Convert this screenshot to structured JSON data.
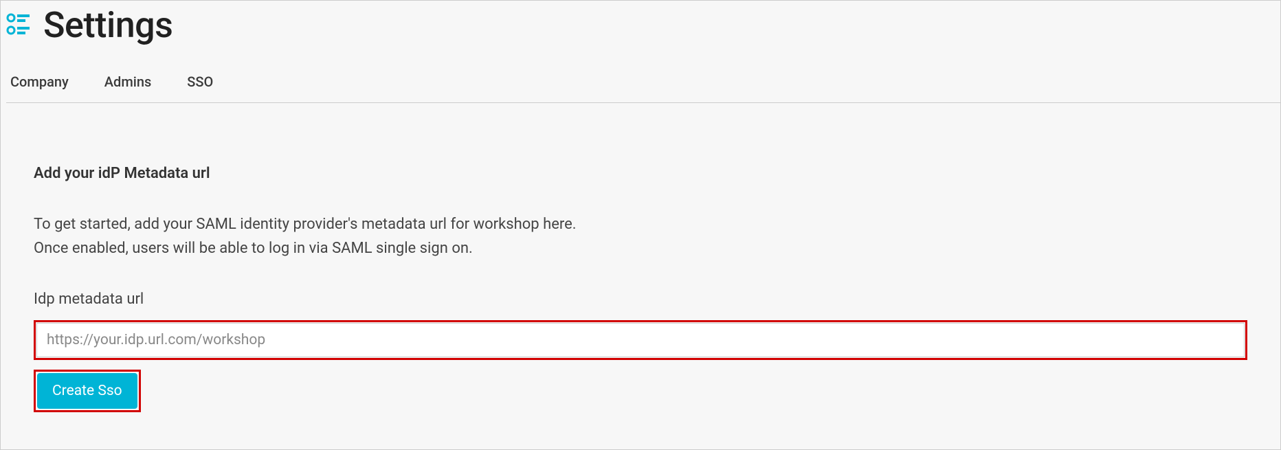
{
  "header": {
    "title": "Settings"
  },
  "tabs": {
    "items": [
      {
        "label": "Company"
      },
      {
        "label": "Admins"
      },
      {
        "label": "SSO"
      }
    ]
  },
  "content": {
    "heading": "Add your idP Metadata url",
    "description_line1": "To get started, add your SAML identity provider's metadata url for workshop here.",
    "description_line2": "Once enabled, users will be able to log in via SAML single sign on.",
    "field_label": "Idp metadata url",
    "input_placeholder": "https://your.idp.url.com/workshop",
    "button_label": "Create Sso"
  },
  "colors": {
    "accent": "#00b4d6",
    "highlight_border": "#d10000"
  }
}
